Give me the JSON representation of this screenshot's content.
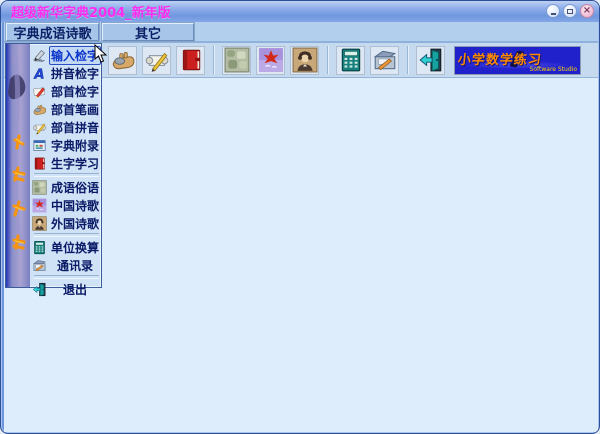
{
  "window": {
    "title": "超级新华字典2004_新年版",
    "controls": {
      "minimize": {
        "icon": "minimize-icon"
      },
      "maximize": {
        "icon": "maximize-icon"
      },
      "close": {
        "icon": "close-icon"
      }
    }
  },
  "menubar": {
    "tabs": [
      {
        "label": "字典成语诗歌",
        "active": true
      },
      {
        "label": "其它",
        "active": false
      }
    ]
  },
  "menu": {
    "items": [
      {
        "label": "输入检字",
        "icon": "pen-writing-icon",
        "highlighted": true
      },
      {
        "label": "拼音检字",
        "icon": "letter-a-icon"
      },
      {
        "label": "部首检字",
        "icon": "card-pencil-icon"
      },
      {
        "label": "部首笔画",
        "icon": "hand-stone-icon"
      },
      {
        "label": "部首拼音",
        "icon": "scroll-pencil-icon"
      },
      {
        "label": "字典附录",
        "icon": "notes-window-icon"
      },
      {
        "label": "生字学习",
        "icon": "red-book-icon"
      },
      {
        "label": "成语俗语",
        "icon": "stone-texture-icon"
      },
      {
        "label": "中国诗歌",
        "icon": "maple-leaf-icon"
      },
      {
        "label": "外国诗歌",
        "icon": "portrait-icon"
      },
      {
        "label": "单位换算",
        "icon": "calculator-icon"
      },
      {
        "label": "通讯录",
        "icon": "rolodex-icon"
      },
      {
        "label": "退出",
        "icon": "exit-door-icon"
      }
    ]
  },
  "toolbar": {
    "buttons": [
      {
        "icon": "hand-stone-icon"
      },
      {
        "icon": "scroll-pencil-icon"
      },
      {
        "icon": "red-book-icon"
      },
      {
        "icon": "stone-texture-icon"
      },
      {
        "icon": "maple-leaf-icon"
      },
      {
        "icon": "portrait-icon"
      },
      {
        "icon": "calculator-icon"
      },
      {
        "icon": "rolodex-icon"
      },
      {
        "icon": "exit-door-icon"
      }
    ],
    "banner": {
      "title": "小学数学练习",
      "subtitle": "Software Studio"
    }
  },
  "colors": {
    "title_text": "#ff2cf0",
    "titlebar_blue": "#7e9fe0",
    "menu_text": "#0a1a66",
    "highlight_blue": "#2b4fc4",
    "banner_bg": "#2121cc",
    "banner_text": "#ff8a00",
    "content_bg": "#ddedfc"
  }
}
